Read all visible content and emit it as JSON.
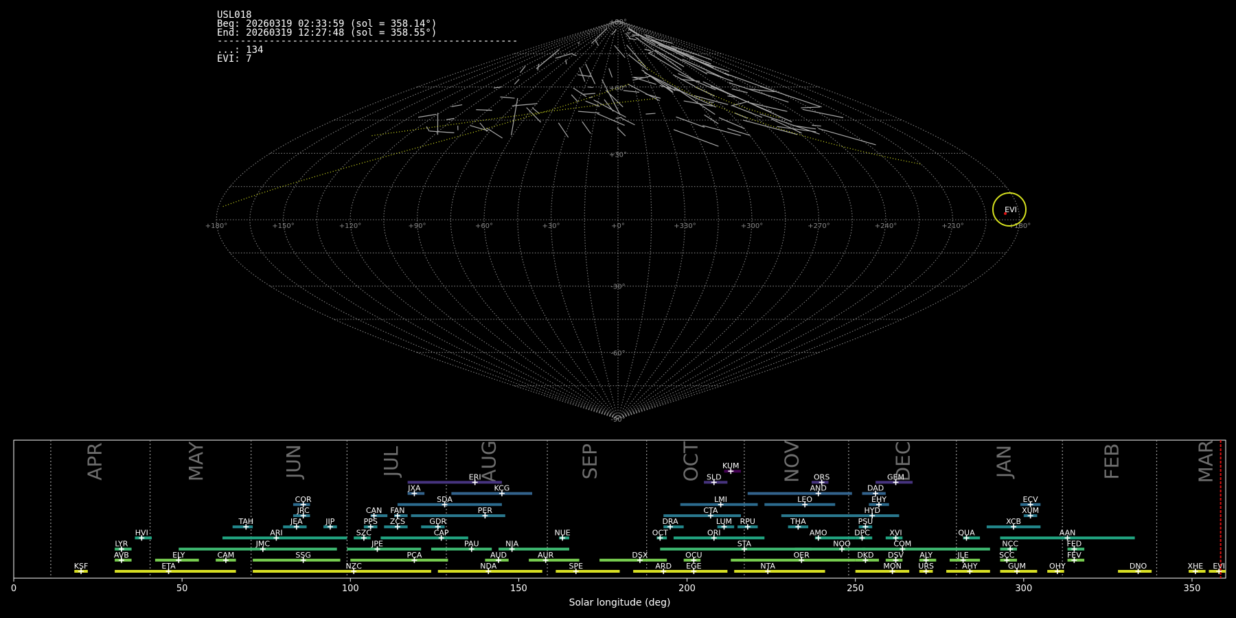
{
  "info": {
    "station": "USL018",
    "begin": "Beg: 20260319 02:33:59 (sol = 358.14°)",
    "end": "End: 20260319 12:27:48 (sol = 358.55°)",
    "separator": "----------------------------------------------------",
    "count_unassoc": "...: 134",
    "count_evi": "EVI: 7"
  },
  "colors": {
    "background": "#000000",
    "grid": "#9a9a9a",
    "meteor": "#a9a9a9",
    "shower_evi": "#d7e21f",
    "current_sol": "#e01010"
  },
  "chart_data": [
    {
      "type": "scatter",
      "title": "",
      "projection": "sinusoidal",
      "lon_tick_labels": [
        "+180°",
        "+150°",
        "+120°",
        "+90°",
        "+60°",
        "+30°",
        "+0°",
        "+330°",
        "+300°",
        "+270°",
        "+240°",
        "+210°",
        "+180°"
      ],
      "lat_tick_labels": [
        "+90°",
        "+60°",
        "+30°",
        "-30°",
        "-60°",
        "-90°"
      ],
      "grid": true,
      "shower_radiant": {
        "label": "EVI",
        "lon": 176,
        "lat": 3
      }
    },
    {
      "type": "bar",
      "xlabel": "Solar longitude (deg)",
      "xlim": [
        0,
        360
      ],
      "xticks": [
        0,
        50,
        100,
        150,
        200,
        250,
        300,
        350
      ],
      "current_sol": 358.5,
      "month_boundaries": [
        11,
        40.5,
        70.5,
        99,
        128.5,
        158.5,
        188,
        217,
        248,
        280,
        311.5,
        339.5
      ],
      "months": [
        {
          "name": "APR",
          "sol": 24
        },
        {
          "name": "MAY",
          "sol": 54
        },
        {
          "name": "JUN",
          "sol": 83
        },
        {
          "name": "JUL",
          "sol": 112
        },
        {
          "name": "AUG",
          "sol": 141
        },
        {
          "name": "SEP",
          "sol": 171
        },
        {
          "name": "OCT",
          "sol": 201
        },
        {
          "name": "NOV",
          "sol": 231
        },
        {
          "name": "DEC",
          "sol": 264
        },
        {
          "name": "JAN",
          "sol": 294
        },
        {
          "name": "FEB",
          "sol": 326
        },
        {
          "name": "MAR",
          "sol": 354
        }
      ],
      "showers": [
        {
          "code": "KSF",
          "start": 18,
          "end": 22,
          "peak": 20,
          "row": 0,
          "color": "#d9e023"
        },
        {
          "code": "ETA",
          "start": 30,
          "end": 66,
          "peak": 46,
          "row": 0,
          "color": "#d9e023"
        },
        {
          "code": "NZC",
          "start": 71,
          "end": 124,
          "peak": 101,
          "row": 0,
          "color": "#d9e023"
        },
        {
          "code": "NDA",
          "start": 126,
          "end": 157,
          "peak": 141,
          "row": 0,
          "color": "#d9e023"
        },
        {
          "code": "SPE",
          "start": 161,
          "end": 180,
          "peak": 167,
          "row": 0,
          "color": "#d9e023"
        },
        {
          "code": "ARD",
          "start": 184,
          "end": 198,
          "peak": 193,
          "row": 0,
          "color": "#d9e023"
        },
        {
          "code": "EGE",
          "start": 197,
          "end": 212,
          "peak": 202,
          "row": 0,
          "color": "#d9e023"
        },
        {
          "code": "NTA",
          "start": 214,
          "end": 241,
          "peak": 224,
          "row": 0,
          "color": "#d9e023"
        },
        {
          "code": "MON",
          "start": 250,
          "end": 266,
          "peak": 261,
          "row": 0,
          "color": "#d9e023"
        },
        {
          "code": "URS",
          "start": 269,
          "end": 273,
          "peak": 271,
          "row": 0,
          "color": "#d9e023"
        },
        {
          "code": "AHY",
          "start": 277,
          "end": 290,
          "peak": 284,
          "row": 0,
          "color": "#d9e023"
        },
        {
          "code": "GUM",
          "start": 293,
          "end": 304,
          "peak": 298,
          "row": 0,
          "color": "#d9e023"
        },
        {
          "code": "OHY",
          "start": 307,
          "end": 312,
          "peak": 310,
          "row": 0,
          "color": "#d9e023"
        },
        {
          "code": "DNO",
          "start": 328,
          "end": 338,
          "peak": 334,
          "row": 0,
          "color": "#d9e023"
        },
        {
          "code": "XHE",
          "start": 349,
          "end": 354,
          "peak": 351,
          "row": 0,
          "color": "#d9e023"
        },
        {
          "code": "EVI",
          "start": 355,
          "end": 360,
          "peak": 358,
          "row": 0,
          "color": "#d9e023"
        },
        {
          "code": "AVB",
          "start": 30,
          "end": 35,
          "peak": 32,
          "row": 1,
          "color": "#7ad151"
        },
        {
          "code": "ELY",
          "start": 42,
          "end": 55,
          "peak": 49,
          "row": 1,
          "color": "#7ad151"
        },
        {
          "code": "CAM",
          "start": 60,
          "end": 66,
          "peak": 63,
          "row": 1,
          "color": "#7ad151"
        },
        {
          "code": "SSG",
          "start": 71,
          "end": 97,
          "peak": 86,
          "row": 1,
          "color": "#7ad151"
        },
        {
          "code": "PCA",
          "start": 100,
          "end": 129,
          "peak": 119,
          "row": 1,
          "color": "#7ad151"
        },
        {
          "code": "AUD",
          "start": 140,
          "end": 147,
          "peak": 144,
          "row": 1,
          "color": "#7ad151"
        },
        {
          "code": "AUR",
          "start": 153,
          "end": 168,
          "peak": 158,
          "row": 1,
          "color": "#7ad151"
        },
        {
          "code": "DSX",
          "start": 174,
          "end": 194,
          "peak": 186,
          "row": 1,
          "color": "#7ad151"
        },
        {
          "code": "OCU",
          "start": 199,
          "end": 204,
          "peak": 202,
          "row": 1,
          "color": "#7ad151"
        },
        {
          "code": "OER",
          "start": 213,
          "end": 250,
          "peak": 234,
          "row": 1,
          "color": "#7ad151"
        },
        {
          "code": "DKD",
          "start": 250,
          "end": 257,
          "peak": 253,
          "row": 1,
          "color": "#7ad151"
        },
        {
          "code": "DSV",
          "start": 259,
          "end": 264,
          "peak": 262,
          "row": 1,
          "color": "#7ad151"
        },
        {
          "code": "ALY",
          "start": 269,
          "end": 274,
          "peak": 271,
          "row": 1,
          "color": "#7ad151"
        },
        {
          "code": "JLE",
          "start": 278,
          "end": 287,
          "peak": 282,
          "row": 1,
          "color": "#7ad151"
        },
        {
          "code": "SCC",
          "start": 293,
          "end": 298,
          "peak": 295,
          "row": 1,
          "color": "#7ad151"
        },
        {
          "code": "FEV",
          "start": 313,
          "end": 318,
          "peak": 315,
          "row": 1,
          "color": "#7ad151"
        },
        {
          "code": "LYR",
          "start": 30,
          "end": 35,
          "peak": 32,
          "row": 2,
          "color": "#3fbc73"
        },
        {
          "code": "JMC",
          "start": 49,
          "end": 96,
          "peak": 74,
          "row": 2,
          "color": "#3fbc73"
        },
        {
          "code": "JPE",
          "start": 99,
          "end": 121,
          "peak": 108,
          "row": 2,
          "color": "#3fbc73"
        },
        {
          "code": "PAU",
          "start": 124,
          "end": 142,
          "peak": 136,
          "row": 2,
          "color": "#3fbc73"
        },
        {
          "code": "NIA",
          "start": 144,
          "end": 165,
          "peak": 148,
          "row": 2,
          "color": "#3fbc73"
        },
        {
          "code": "STA",
          "start": 192,
          "end": 237,
          "peak": 217,
          "row": 2,
          "color": "#3fbc73"
        },
        {
          "code": "NOO",
          "start": 232,
          "end": 253,
          "peak": 246,
          "row": 2,
          "color": "#3fbc73"
        },
        {
          "code": "COM",
          "start": 252,
          "end": 290,
          "peak": 264,
          "row": 2,
          "color": "#3fbc73"
        },
        {
          "code": "NCC",
          "start": 293,
          "end": 298,
          "peak": 296,
          "row": 2,
          "color": "#3fbc73"
        },
        {
          "code": "FED",
          "start": 313,
          "end": 318,
          "peak": 315,
          "row": 2,
          "color": "#3fbc73"
        },
        {
          "code": "HVI",
          "start": 36,
          "end": 41,
          "peak": 38,
          "row": 3,
          "color": "#22a884"
        },
        {
          "code": "ARI",
          "start": 62,
          "end": 99,
          "peak": 78,
          "row": 3,
          "color": "#22a884"
        },
        {
          "code": "SZC",
          "start": 101,
          "end": 106,
          "peak": 104,
          "row": 3,
          "color": "#22a884"
        },
        {
          "code": "CAP",
          "start": 109,
          "end": 135,
          "peak": 127,
          "row": 3,
          "color": "#22a884"
        },
        {
          "code": "NUE",
          "start": 162,
          "end": 165,
          "peak": 163,
          "row": 3,
          "color": "#22a884"
        },
        {
          "code": "OCT",
          "start": 191,
          "end": 194,
          "peak": 192,
          "row": 3,
          "color": "#22a884"
        },
        {
          "code": "ORI",
          "start": 196,
          "end": 223,
          "peak": 208,
          "row": 3,
          "color": "#22a884"
        },
        {
          "code": "AMO",
          "start": 238,
          "end": 250,
          "peak": 239,
          "row": 3,
          "color": "#22a884"
        },
        {
          "code": "DPC",
          "start": 250,
          "end": 255,
          "peak": 252,
          "row": 3,
          "color": "#22a884"
        },
        {
          "code": "XVI",
          "start": 259,
          "end": 264,
          "peak": 262,
          "row": 3,
          "color": "#22a884"
        },
        {
          "code": "QUA",
          "start": 282,
          "end": 287,
          "peak": 283,
          "row": 3,
          "color": "#22a884"
        },
        {
          "code": "AAN",
          "start": 293,
          "end": 333,
          "peak": 313,
          "row": 3,
          "color": "#22a884"
        },
        {
          "code": "TAH",
          "start": 65,
          "end": 71,
          "peak": 69,
          "row": 4,
          "color": "#23898e"
        },
        {
          "code": "JEA",
          "start": 80,
          "end": 87,
          "peak": 84,
          "row": 4,
          "color": "#23898e"
        },
        {
          "code": "JIP",
          "start": 92,
          "end": 96,
          "peak": 94,
          "row": 4,
          "color": "#23898e"
        },
        {
          "code": "PPS",
          "start": 104,
          "end": 108,
          "peak": 106,
          "row": 4,
          "color": "#23898e"
        },
        {
          "code": "ZCS",
          "start": 110,
          "end": 117,
          "peak": 114,
          "row": 4,
          "color": "#23898e"
        },
        {
          "code": "GDR",
          "start": 121,
          "end": 128,
          "peak": 126,
          "row": 4,
          "color": "#23898e"
        },
        {
          "code": "DRA",
          "start": 193,
          "end": 199,
          "peak": 195,
          "row": 4,
          "color": "#23898e"
        },
        {
          "code": "LUM",
          "start": 209,
          "end": 214,
          "peak": 211,
          "row": 4,
          "color": "#23898e"
        },
        {
          "code": "RPU",
          "start": 215,
          "end": 221,
          "peak": 218,
          "row": 4,
          "color": "#23898e"
        },
        {
          "code": "THA",
          "start": 230,
          "end": 236,
          "peak": 233,
          "row": 4,
          "color": "#23898e"
        },
        {
          "code": "PSU",
          "start": 251,
          "end": 255,
          "peak": 253,
          "row": 4,
          "color": "#23898e"
        },
        {
          "code": "XCB",
          "start": 289,
          "end": 305,
          "peak": 297,
          "row": 4,
          "color": "#23898e"
        },
        {
          "code": "JRC",
          "start": 83,
          "end": 88,
          "peak": 86,
          "row": 5,
          "color": "#2a788e"
        },
        {
          "code": "CAN",
          "start": 106,
          "end": 111,
          "peak": 107,
          "row": 5,
          "color": "#2a788e"
        },
        {
          "code": "FAN",
          "start": 113,
          "end": 117,
          "peak": 114,
          "row": 5,
          "color": "#2a788e"
        },
        {
          "code": "PER",
          "start": 118,
          "end": 146,
          "peak": 140,
          "row": 5,
          "color": "#2a788e"
        },
        {
          "code": "CTA",
          "start": 193,
          "end": 216,
          "peak": 207,
          "row": 5,
          "color": "#2a788e"
        },
        {
          "code": "HYD",
          "start": 228,
          "end": 263,
          "peak": 255,
          "row": 5,
          "color": "#2a788e"
        },
        {
          "code": "XUM",
          "start": 300,
          "end": 304,
          "peak": 302,
          "row": 5,
          "color": "#2a788e"
        },
        {
          "code": "COR",
          "start": 83,
          "end": 88,
          "peak": 86,
          "row": 6,
          "color": "#2c6b8e"
        },
        {
          "code": "SDA",
          "start": 114,
          "end": 145,
          "peak": 128,
          "row": 6,
          "color": "#2c6b8e"
        },
        {
          "code": "LMI",
          "start": 198,
          "end": 221,
          "peak": 210,
          "row": 6,
          "color": "#2c6b8e"
        },
        {
          "code": "LEO",
          "start": 223,
          "end": 244,
          "peak": 235,
          "row": 6,
          "color": "#2c6b8e"
        },
        {
          "code": "EHY",
          "start": 254,
          "end": 260,
          "peak": 257,
          "row": 6,
          "color": "#2c6b8e"
        },
        {
          "code": "ECV",
          "start": 299,
          "end": 305,
          "peak": 302,
          "row": 6,
          "color": "#2c6b8e"
        },
        {
          "code": "JXA",
          "start": 117,
          "end": 122,
          "peak": 119,
          "row": 7,
          "color": "#33638d"
        },
        {
          "code": "KCG",
          "start": 130,
          "end": 154,
          "peak": 145,
          "row": 7,
          "color": "#33638d"
        },
        {
          "code": "AND",
          "start": 218,
          "end": 249,
          "peak": 239,
          "row": 7,
          "color": "#33638d"
        },
        {
          "code": "DAD",
          "start": 252,
          "end": 259,
          "peak": 256,
          "row": 7,
          "color": "#33638d"
        },
        {
          "code": "ERI",
          "start": 117,
          "end": 145,
          "peak": 137,
          "row": 8,
          "color": "#46337e"
        },
        {
          "code": "SLD",
          "start": 205,
          "end": 212,
          "peak": 208,
          "row": 8,
          "color": "#46337e"
        },
        {
          "code": "ORS",
          "start": 237,
          "end": 242,
          "peak": 240,
          "row": 8,
          "color": "#46337e"
        },
        {
          "code": "GEM",
          "start": 256,
          "end": 267,
          "peak": 262,
          "row": 8,
          "color": "#46337e"
        },
        {
          "code": "KUM",
          "start": 211,
          "end": 216,
          "peak": 213,
          "row": 9,
          "color": "#440154"
        }
      ]
    }
  ]
}
